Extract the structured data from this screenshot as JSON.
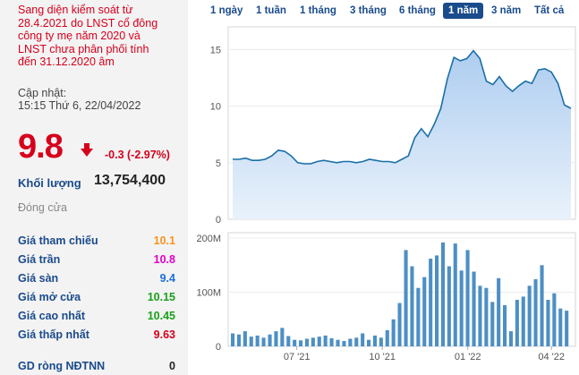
{
  "notice": {
    "lines": [
      "Sang diện kiểm soát từ",
      "28.4.2021 do LNST cổ đông",
      "công ty mẹ năm 2020 và",
      "LNST chưa phân phối tính",
      "đến 31.12.2020 âm"
    ]
  },
  "update": {
    "label": "Cập nhật:",
    "time": "15:15 Thứ 6, 22/04/2022"
  },
  "quote": {
    "price": "9.8",
    "change": "-0.3 (-2.97%)",
    "price_color": "#d6001c"
  },
  "volume": {
    "label": "Khối lượng",
    "value": "13,754,400"
  },
  "status": {
    "closed": "Đóng cửa"
  },
  "stats": [
    {
      "label": "Giá tham chiếu",
      "value": "10.1",
      "color": "#f7941d"
    },
    {
      "label": "Giá trần",
      "value": "10.8",
      "color": "#e000c8"
    },
    {
      "label": "Giá sàn",
      "value": "9.4",
      "color": "#1a6fd6"
    },
    {
      "label": "Giá mở cửa",
      "value": "10.15",
      "color": "#1aa01a"
    },
    {
      "label": "Giá cao nhất",
      "value": "10.45",
      "color": "#1aa01a"
    },
    {
      "label": "Giá thấp nhất",
      "value": "9.63",
      "color": "#d6001c"
    }
  ],
  "foreign": {
    "label": "GD ròng NĐTNN",
    "value": "0"
  },
  "range_tabs": [
    {
      "label": "1 ngày",
      "active": false
    },
    {
      "label": "1 tuần",
      "active": false
    },
    {
      "label": "1 tháng",
      "active": false
    },
    {
      "label": "3 tháng",
      "active": false
    },
    {
      "label": "6 tháng",
      "active": false
    },
    {
      "label": "1 năm",
      "active": true
    },
    {
      "label": "3 năm",
      "active": false
    },
    {
      "label": "Tất cả",
      "active": false
    }
  ],
  "chart_data": [
    {
      "type": "area",
      "ylim": [
        0,
        17
      ],
      "yticks": [
        0,
        5,
        10,
        15
      ],
      "ytick_labels": [
        "0",
        "5",
        "10",
        "15"
      ],
      "grid": true,
      "colors": {
        "line": "#1a6fa8",
        "fill_top": "#aecdf0",
        "fill_bottom": "#e9f2fb"
      },
      "x": [
        "2021-04-23",
        "2021-04-30",
        "2021-05-07",
        "2021-05-14",
        "2021-05-21",
        "2021-05-28",
        "2021-06-04",
        "2021-06-11",
        "2021-06-18",
        "2021-06-25",
        "2021-07-02",
        "2021-07-09",
        "2021-07-16",
        "2021-07-23",
        "2021-07-30",
        "2021-08-06",
        "2021-08-13",
        "2021-08-20",
        "2021-08-27",
        "2021-09-03",
        "2021-09-10",
        "2021-09-17",
        "2021-09-24",
        "2021-10-01",
        "2021-10-08",
        "2021-10-15",
        "2021-10-22",
        "2021-10-29",
        "2021-11-05",
        "2021-11-12",
        "2021-11-19",
        "2021-11-26",
        "2021-12-03",
        "2021-12-10",
        "2021-12-17",
        "2021-12-24",
        "2021-12-31",
        "2022-01-07",
        "2022-01-14",
        "2022-01-21",
        "2022-01-28",
        "2022-02-04",
        "2022-02-11",
        "2022-02-18",
        "2022-02-25",
        "2022-03-04",
        "2022-03-11",
        "2022-03-18",
        "2022-03-25",
        "2022-04-01",
        "2022-04-08",
        "2022-04-15",
        "2022-04-22"
      ],
      "values": [
        5.3,
        5.3,
        5.4,
        5.2,
        5.2,
        5.3,
        5.6,
        6.1,
        6.0,
        5.6,
        5.0,
        4.9,
        4.9,
        5.1,
        5.2,
        5.1,
        5.0,
        5.1,
        5.1,
        5.0,
        5.1,
        5.3,
        5.2,
        5.1,
        5.1,
        5.0,
        5.3,
        5.6,
        7.2,
        8.0,
        7.3,
        8.4,
        9.8,
        12.4,
        14.3,
        14.0,
        14.2,
        14.9,
        14.2,
        12.2,
        11.9,
        12.6,
        11.8,
        11.3,
        11.8,
        12.2,
        12.0,
        13.2,
        13.3,
        13.0,
        12.0,
        10.1,
        9.8
      ]
    },
    {
      "type": "bar",
      "ylim": [
        0,
        210
      ],
      "yticks": [
        0,
        100,
        200
      ],
      "ytick_labels": [
        "0",
        "100M",
        "200M"
      ],
      "grid": true,
      "bar_color": "#4d8fc4",
      "xtick_labels": [
        "07 '21",
        "10 '21",
        "01 '22",
        "04 '22"
      ],
      "xtick_dates": [
        "2021-07-01",
        "2021-10-01",
        "2022-01-01",
        "2022-04-01"
      ],
      "values": [
        24,
        22,
        28,
        18,
        20,
        16,
        22,
        28,
        34,
        19,
        12,
        11,
        14,
        16,
        18,
        20,
        15,
        12,
        10,
        14,
        16,
        24,
        12,
        20,
        16,
        30,
        50,
        80,
        178,
        148,
        108,
        128,
        162,
        168,
        192,
        148,
        190,
        140,
        178,
        138,
        112,
        108,
        82,
        126,
        76,
        28,
        86,
        92,
        112,
        124,
        150,
        86,
        98,
        70,
        66
      ]
    }
  ]
}
